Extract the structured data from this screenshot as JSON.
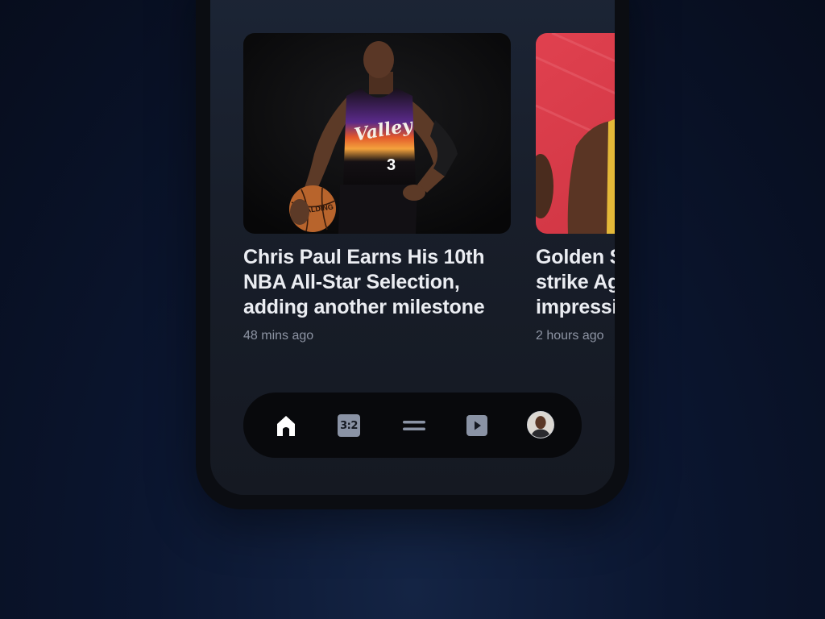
{
  "articles": [
    {
      "headline_lines": [
        "Chris Paul Earns His 10th",
        "NBA All-Star Selection,",
        "adding another milestone"
      ],
      "time": "48 mins ago",
      "image": "chris-paul-photo"
    },
    {
      "headline_lines": [
        "Golden State Warriors",
        "strike Against",
        "impressive"
      ],
      "time": "2 hours ago",
      "image": "basketball-player-photo"
    }
  ],
  "nav": {
    "items": [
      {
        "icon": "home-icon",
        "label": ""
      },
      {
        "icon": "scores-icon",
        "label": "3:2"
      },
      {
        "icon": "menu-icon",
        "label": ""
      },
      {
        "icon": "video-play-icon",
        "label": ""
      },
      {
        "icon": "profile-avatar",
        "label": ""
      }
    ]
  },
  "colors": {
    "background": "#0b1630",
    "phone_frame": "#0b0d12",
    "screen": "#1a2130",
    "headline": "#ebedf2",
    "meta": "#8d94a3",
    "nav_bg": "#08090c",
    "nav_icon": "#8a93a5",
    "nav_active": "#ffffff",
    "card2_accent": "#d9384a"
  }
}
